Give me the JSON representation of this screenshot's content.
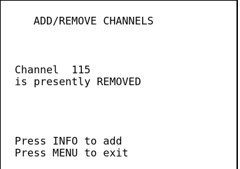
{
  "screen": {
    "title": "ADD/REMOVE CHANNELS",
    "status_line_1": "Channel  115",
    "status_line_2": "is presently REMOVED",
    "instruction_add": "Press INFO to add",
    "instruction_exit": "Press MENU to exit"
  }
}
